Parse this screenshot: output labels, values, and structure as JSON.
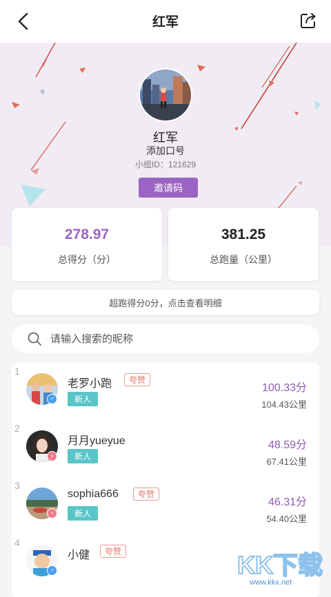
{
  "header": {
    "title": "红军"
  },
  "hero": {
    "group_name": "红军",
    "add_slogan": "添加口号",
    "group_id_text": "小组ID：121629",
    "invite_label": "邀请码"
  },
  "stats": {
    "total_score": "278.97",
    "total_score_label": "总得分（分）",
    "total_distance": "381.25",
    "total_distance_label": "总跑量（公里）"
  },
  "detail_text": "超跑得分0分，点击查看明细",
  "search": {
    "placeholder": "请输入搜索的昵称"
  },
  "members": [
    {
      "rank": "1",
      "name": "老罗小跑",
      "praise": "夸赞",
      "badge": "新人",
      "score": "100.33分",
      "distance": "104.43公里",
      "gender": "male"
    },
    {
      "rank": "2",
      "name": "月月yueyue",
      "praise": "",
      "badge": "新人",
      "score": "48.59分",
      "distance": "67.41公里",
      "gender": "female"
    },
    {
      "rank": "3",
      "name": "sophia666",
      "praise": "夸赞",
      "badge": "新人",
      "score": "46.31分",
      "distance": "54.40公里",
      "gender": "female"
    },
    {
      "rank": "4",
      "name": "小健",
      "praise": "夸赞",
      "badge": "",
      "score": "",
      "distance": "",
      "gender": "male"
    }
  ],
  "watermark": {
    "text": "KK下载",
    "url": "www.kkx.net"
  },
  "colors": {
    "accent": "#9b64c4",
    "newbie": "#5bc4c8",
    "praise": "#e0766a"
  }
}
